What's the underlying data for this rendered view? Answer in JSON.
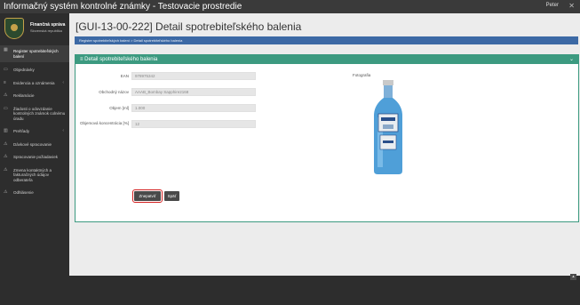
{
  "topbar": {
    "title": "Informačný systém kontrolné známky - Testovacie prostredie",
    "user": "Peter",
    "close": "✕"
  },
  "brand": {
    "line1": "Finančná správa",
    "line2": "Slovenská republika"
  },
  "sidebar": {
    "items": [
      {
        "label": "Register spotrebiteľských balení",
        "icon": "grid-icon",
        "glyph": "▦",
        "active": true
      },
      {
        "label": "Objednávky",
        "icon": "cart-icon",
        "glyph": "▭"
      },
      {
        "label": "Evidencia a oznámenia",
        "icon": "list-icon",
        "glyph": "≡",
        "chevron": "‹"
      },
      {
        "label": "Reklamácie",
        "icon": "warning-icon",
        "glyph": "⚠"
      },
      {
        "label": "Žiadosti o odovzdanie kontrolných známok colnému úradu",
        "icon": "box-icon",
        "glyph": "▭"
      },
      {
        "label": "Prehľady",
        "icon": "chart-icon",
        "glyph": "▥",
        "chevron": "‹"
      },
      {
        "label": "Dávkové spracovanie",
        "icon": "batch-icon",
        "glyph": "⚠"
      },
      {
        "label": "Spracovanie požiadaviek",
        "icon": "request-icon",
        "glyph": "⚠"
      },
      {
        "label": "Zmena kontaktných a fakturačných údajov odberateľa",
        "icon": "contact-icon",
        "glyph": "⚠"
      },
      {
        "label": "Odhlásenie",
        "icon": "logout-icon",
        "glyph": "⚠"
      }
    ]
  },
  "page": {
    "title": "[GUI-13-00-222] Detail spotrebiteľského balenia"
  },
  "breadcrumb": {
    "text": "Register spotrebiteľských balení  >  Detail spotrebiteľského balenia"
  },
  "panel": {
    "title": "Detail spotrebiteľského balenia",
    "fields": [
      {
        "label": "EAN",
        "value": "978975342"
      },
      {
        "label": "Obchodný názov",
        "value": "AAAB_Bombay Sapphire2168"
      },
      {
        "label": "Objem [ml]",
        "value": "1.000"
      },
      {
        "label": "Objemová koncentrácia [%]",
        "value": "12"
      }
    ],
    "photo_label": "Fotografia",
    "buttons": {
      "confirm": "Znepatviť",
      "back": "Späť"
    }
  },
  "colors": {
    "accent_green": "#3c9a80",
    "breadcrumb_blue": "#3c69a5",
    "highlight_red": "#d42020"
  }
}
